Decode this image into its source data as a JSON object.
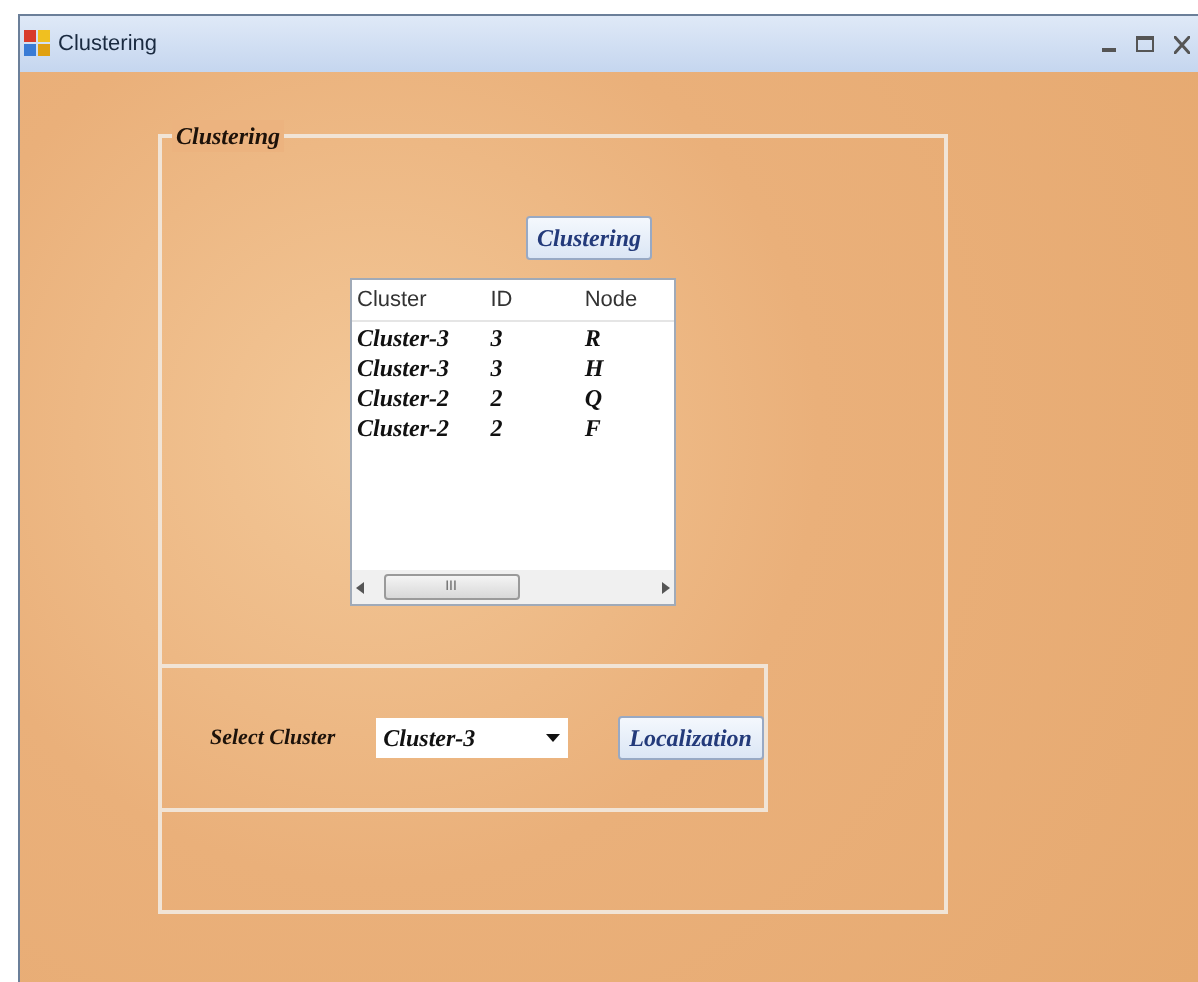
{
  "window": {
    "title": "Clustering"
  },
  "group": {
    "title": "Clustering"
  },
  "cluster_button": {
    "label": "Clustering"
  },
  "table": {
    "columns": [
      "Cluster",
      "ID",
      "Node"
    ],
    "rows": [
      [
        "Cluster-3",
        "3",
        "R"
      ],
      [
        "Cluster-3",
        "3",
        "H"
      ],
      [
        "Cluster-2",
        "2",
        "Q"
      ],
      [
        "Cluster-2",
        "2",
        "F"
      ]
    ],
    "scroll_grip": "III"
  },
  "select_cluster": {
    "label": "Select Cluster",
    "value": "Cluster-3"
  },
  "localization_button": {
    "label": "Localization"
  }
}
